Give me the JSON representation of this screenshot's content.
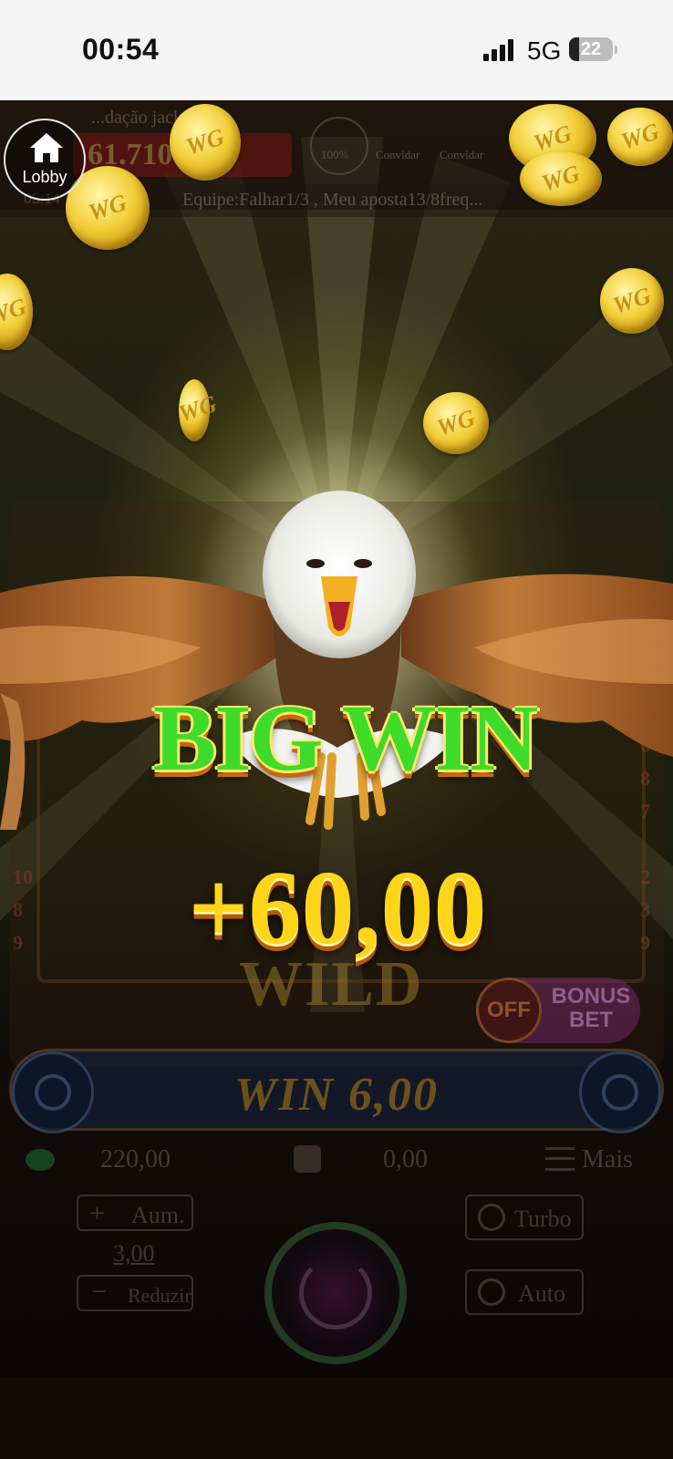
{
  "status_bar": {
    "time": "00:54",
    "network": "5G",
    "battery": "22",
    "battery_level": 0.22
  },
  "lobby": {
    "label": "Lobby"
  },
  "hud": {
    "jackpot_title": "...dação jack...",
    "jackpot_value": "61.710",
    "level_badge": "100%",
    "invite_1": "Convidar",
    "invite_2": "Convidar",
    "ticker_time": "05:14",
    "ticker": "Equipe:Falhar1/3 , Meu aposta13/8freq..."
  },
  "celebration": {
    "title": "BIG WIN",
    "amount": "+60,00",
    "reel_symbol": "WILD"
  },
  "bonus": {
    "toggle": "OFF",
    "label_line1": "BONUS",
    "label_line2": "BET"
  },
  "win_bar": {
    "label": "WIN 6,00"
  },
  "balance": {
    "value": "220,00",
    "win_value": "0,00",
    "more": "Mais"
  },
  "controls": {
    "increase": "Aum.",
    "bet": "3,00",
    "decrease": "Reduzir",
    "turbo": "Turbo",
    "auto": "Auto"
  },
  "coin_mark": "WG",
  "colors": {
    "big_win_green": "#3fdb2a",
    "amount_gold": "#ffd51a",
    "coin_gold": "#f3cf3a"
  }
}
